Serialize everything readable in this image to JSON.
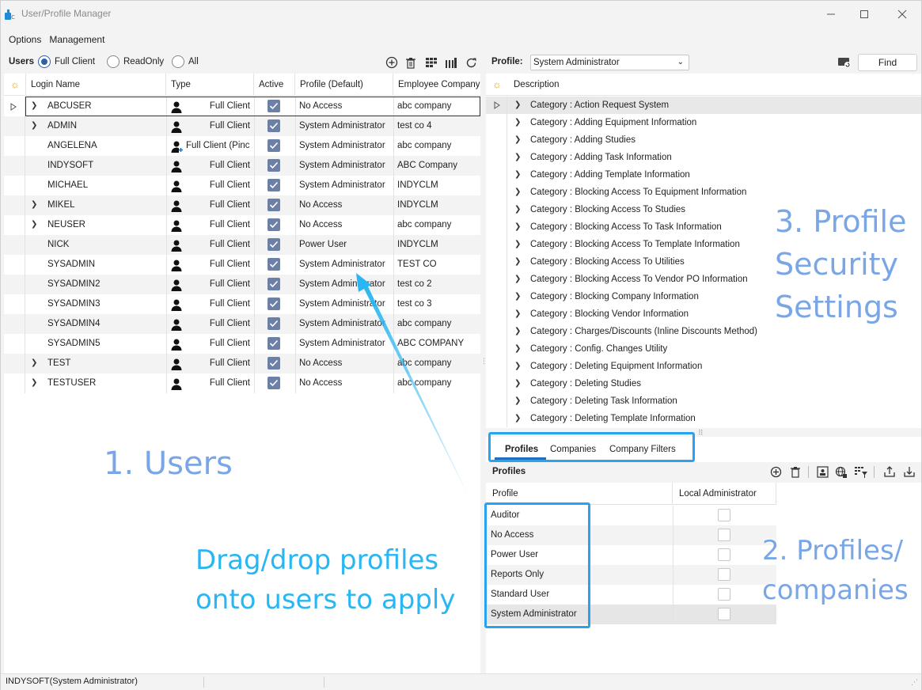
{
  "window": {
    "title": "User/Profile Manager"
  },
  "menu": {
    "options": "Options",
    "management": "Management"
  },
  "users_toolbar": {
    "label": "Users",
    "radios": [
      {
        "label": "Full Client",
        "selected": true
      },
      {
        "label": "ReadOnly",
        "selected": false
      },
      {
        "label": "All",
        "selected": false
      }
    ]
  },
  "users_grid": {
    "columns": [
      "Login Name",
      "Type",
      "Active",
      "Profile (Default)",
      "Employee Company"
    ],
    "rows": [
      {
        "login": "ABCUSER",
        "type": "Full Client",
        "active": true,
        "profile": "No Access",
        "company": "abc company",
        "expandable": true
      },
      {
        "login": "ADMIN",
        "type": "Full Client",
        "active": true,
        "profile": "System Administrator",
        "company": "test co 4",
        "expandable": true
      },
      {
        "login": "ANGELENA",
        "type": "Full Client (Pinc",
        "active": true,
        "profile": "System Administrator",
        "company": "abc company",
        "expandable": false
      },
      {
        "login": "INDYSOFT",
        "type": "Full Client",
        "active": true,
        "profile": "System Administrator",
        "company": "ABC Company",
        "expandable": false
      },
      {
        "login": "MICHAEL",
        "type": "Full Client",
        "active": true,
        "profile": "System Administrator",
        "company": "INDYCLM",
        "expandable": false
      },
      {
        "login": "MIKEL",
        "type": "Full Client",
        "active": true,
        "profile": "No Access",
        "company": "INDYCLM",
        "expandable": true
      },
      {
        "login": "NEUSER",
        "type": "Full Client",
        "active": true,
        "profile": "No Access",
        "company": "abc company",
        "expandable": true
      },
      {
        "login": "NICK",
        "type": "Full Client",
        "active": true,
        "profile": "Power User",
        "company": "INDYCLM",
        "expandable": false
      },
      {
        "login": "SYSADMIN",
        "type": "Full Client",
        "active": true,
        "profile": "System Administrator",
        "company": "TEST CO",
        "expandable": false
      },
      {
        "login": "SYSADMIN2",
        "type": "Full Client",
        "active": true,
        "profile": "System Administrator",
        "company": "test co 2",
        "expandable": false
      },
      {
        "login": "SYSADMIN3",
        "type": "Full Client",
        "active": true,
        "profile": "System Administrator",
        "company": "test co 3",
        "expandable": false
      },
      {
        "login": "SYSADMIN4",
        "type": "Full Client",
        "active": true,
        "profile": "System Administrator",
        "company": "abc company",
        "expandable": false
      },
      {
        "login": "SYSADMIN5",
        "type": "Full Client",
        "active": true,
        "profile": "System Administrator",
        "company": "ABC COMPANY",
        "expandable": false
      },
      {
        "login": "TEST",
        "type": "Full Client",
        "active": true,
        "profile": "No Access",
        "company": "abc company",
        "expandable": true
      },
      {
        "login": "TESTUSER",
        "type": "Full Client",
        "active": true,
        "profile": "No Access",
        "company": "abc company",
        "expandable": true
      }
    ]
  },
  "profile_bar": {
    "label": "Profile:",
    "selected": "System Administrator",
    "find_label": "Find"
  },
  "description_grid": {
    "header": "Description",
    "categories": [
      "Category : Action Request System",
      "Category : Adding Equipment Information",
      "Category : Adding Studies",
      "Category : Adding Task Information",
      "Category : Adding Template Information",
      "Category : Blocking Access To Equipment Information",
      "Category : Blocking Access To Studies",
      "Category : Blocking Access To Task Information",
      "Category : Blocking Access To Template Information",
      "Category : Blocking Access To Utilities",
      "Category : Blocking Access To Vendor PO Information",
      "Category : Blocking Company Information",
      "Category : Blocking Vendor Information",
      "Category : Charges/Discounts (Inline Discounts Method)",
      "Category : Config. Changes Utility",
      "Category : Deleting Equipment Information",
      "Category : Deleting Studies",
      "Category : Deleting Task Information",
      "Category : Deleting Template Information"
    ]
  },
  "tabs": {
    "profiles": "Profiles",
    "companies": "Companies",
    "company_filters": "Company Filters"
  },
  "profiles_panel": {
    "title": "Profiles",
    "columns": [
      "Profile",
      "Local Administrator"
    ],
    "rows": [
      "Auditor",
      "No Access",
      "Power User",
      "Reports Only",
      "Standard User",
      "System Administrator"
    ]
  },
  "status": {
    "text": "INDYSOFT(System Administrator)"
  },
  "annotations": {
    "users": "1. Users",
    "drag_line1": "Drag/drop profiles",
    "drag_line2": "onto users to apply",
    "profiles_line1": "2. Profiles/",
    "profiles_line2": "companies",
    "security_line1": "3. Profile",
    "security_line2": "Security",
    "security_line3": "Settings"
  },
  "colors": {
    "accent": "#2f5fa7",
    "annotation_blue": "#7aa6e6",
    "annotation_cyan": "#29b6f2"
  }
}
